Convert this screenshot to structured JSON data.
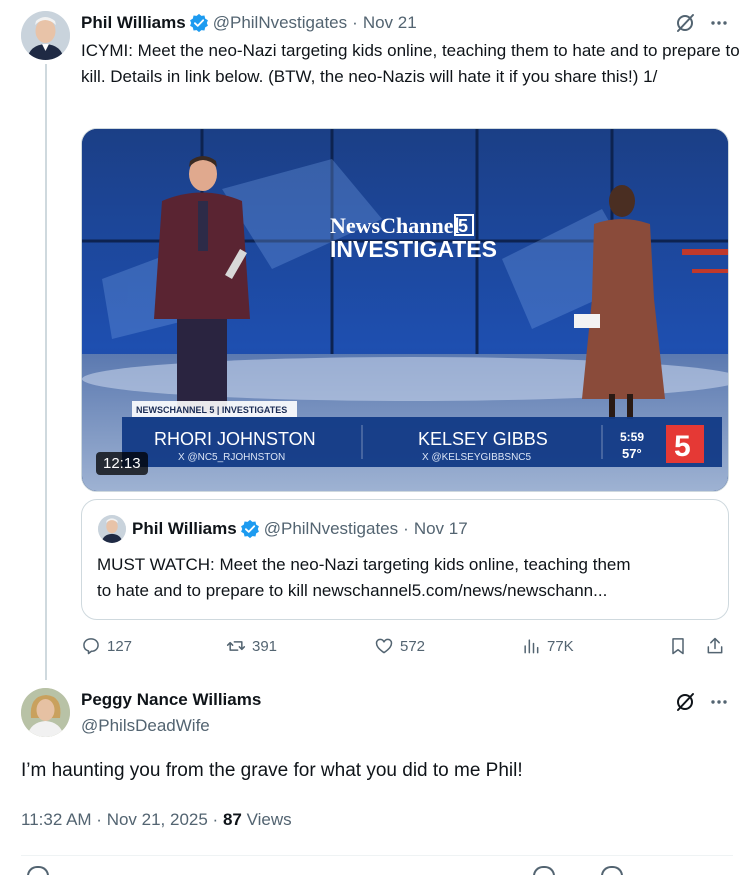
{
  "tweet": {
    "author_name": "Phil Williams",
    "handle": "@PhilNvestigates",
    "date": "Nov 21",
    "text": "ICYMI: Meet the neo-Nazi targeting kids online, teaching them to hate and to prepare to kill. Details in link below. (BTW, the neo-Nazis will hate it if you share this!) 1/",
    "video": {
      "duration": "12:13",
      "logo_line1": "NewsChannel",
      "logo_num": "5",
      "logo_line2": "INVESTIGATES",
      "lower_third_tag": "NEWSCHANNEL 5 | INVESTIGATES",
      "anchor1_name": "RHORI JOHNSTON",
      "anchor1_handle": "X @NC5_RJOHNSTON",
      "anchor2_name": "KELSEY GIBBS",
      "anchor2_handle": "X @KELSEYGIBBSNC5",
      "clock": "5:59",
      "temp": "57°",
      "channel_badge": "5"
    },
    "quote": {
      "author_name": "Phil Williams",
      "handle": "@PhilNvestigates",
      "date": "Nov 17",
      "text_line1": "MUST WATCH: Meet the neo-Nazi targeting kids online, teaching them",
      "text_line2": "to hate and to prepare to kill newschannel5.com/news/newschann..."
    },
    "stats": {
      "replies": "127",
      "reposts": "391",
      "likes": "572",
      "views": "77K"
    }
  },
  "reply": {
    "author_name": "Peggy Nance Williams",
    "handle": "@PhilsDeadWife",
    "text": "I’m haunting you from the grave for what you did to me Phil!",
    "time": "11:32 AM",
    "date": "Nov 21, 2025",
    "views_count": "87",
    "views_label": "Views"
  },
  "colors": {
    "verified_blue": "#1d9bf0",
    "muted_text": "#536471",
    "border": "#cfd9de"
  },
  "icons": [
    "verified-badge-icon",
    "grok-icon",
    "more-icon",
    "reply-icon",
    "repost-icon",
    "like-icon",
    "views-icon",
    "bookmark-icon",
    "share-icon"
  ]
}
